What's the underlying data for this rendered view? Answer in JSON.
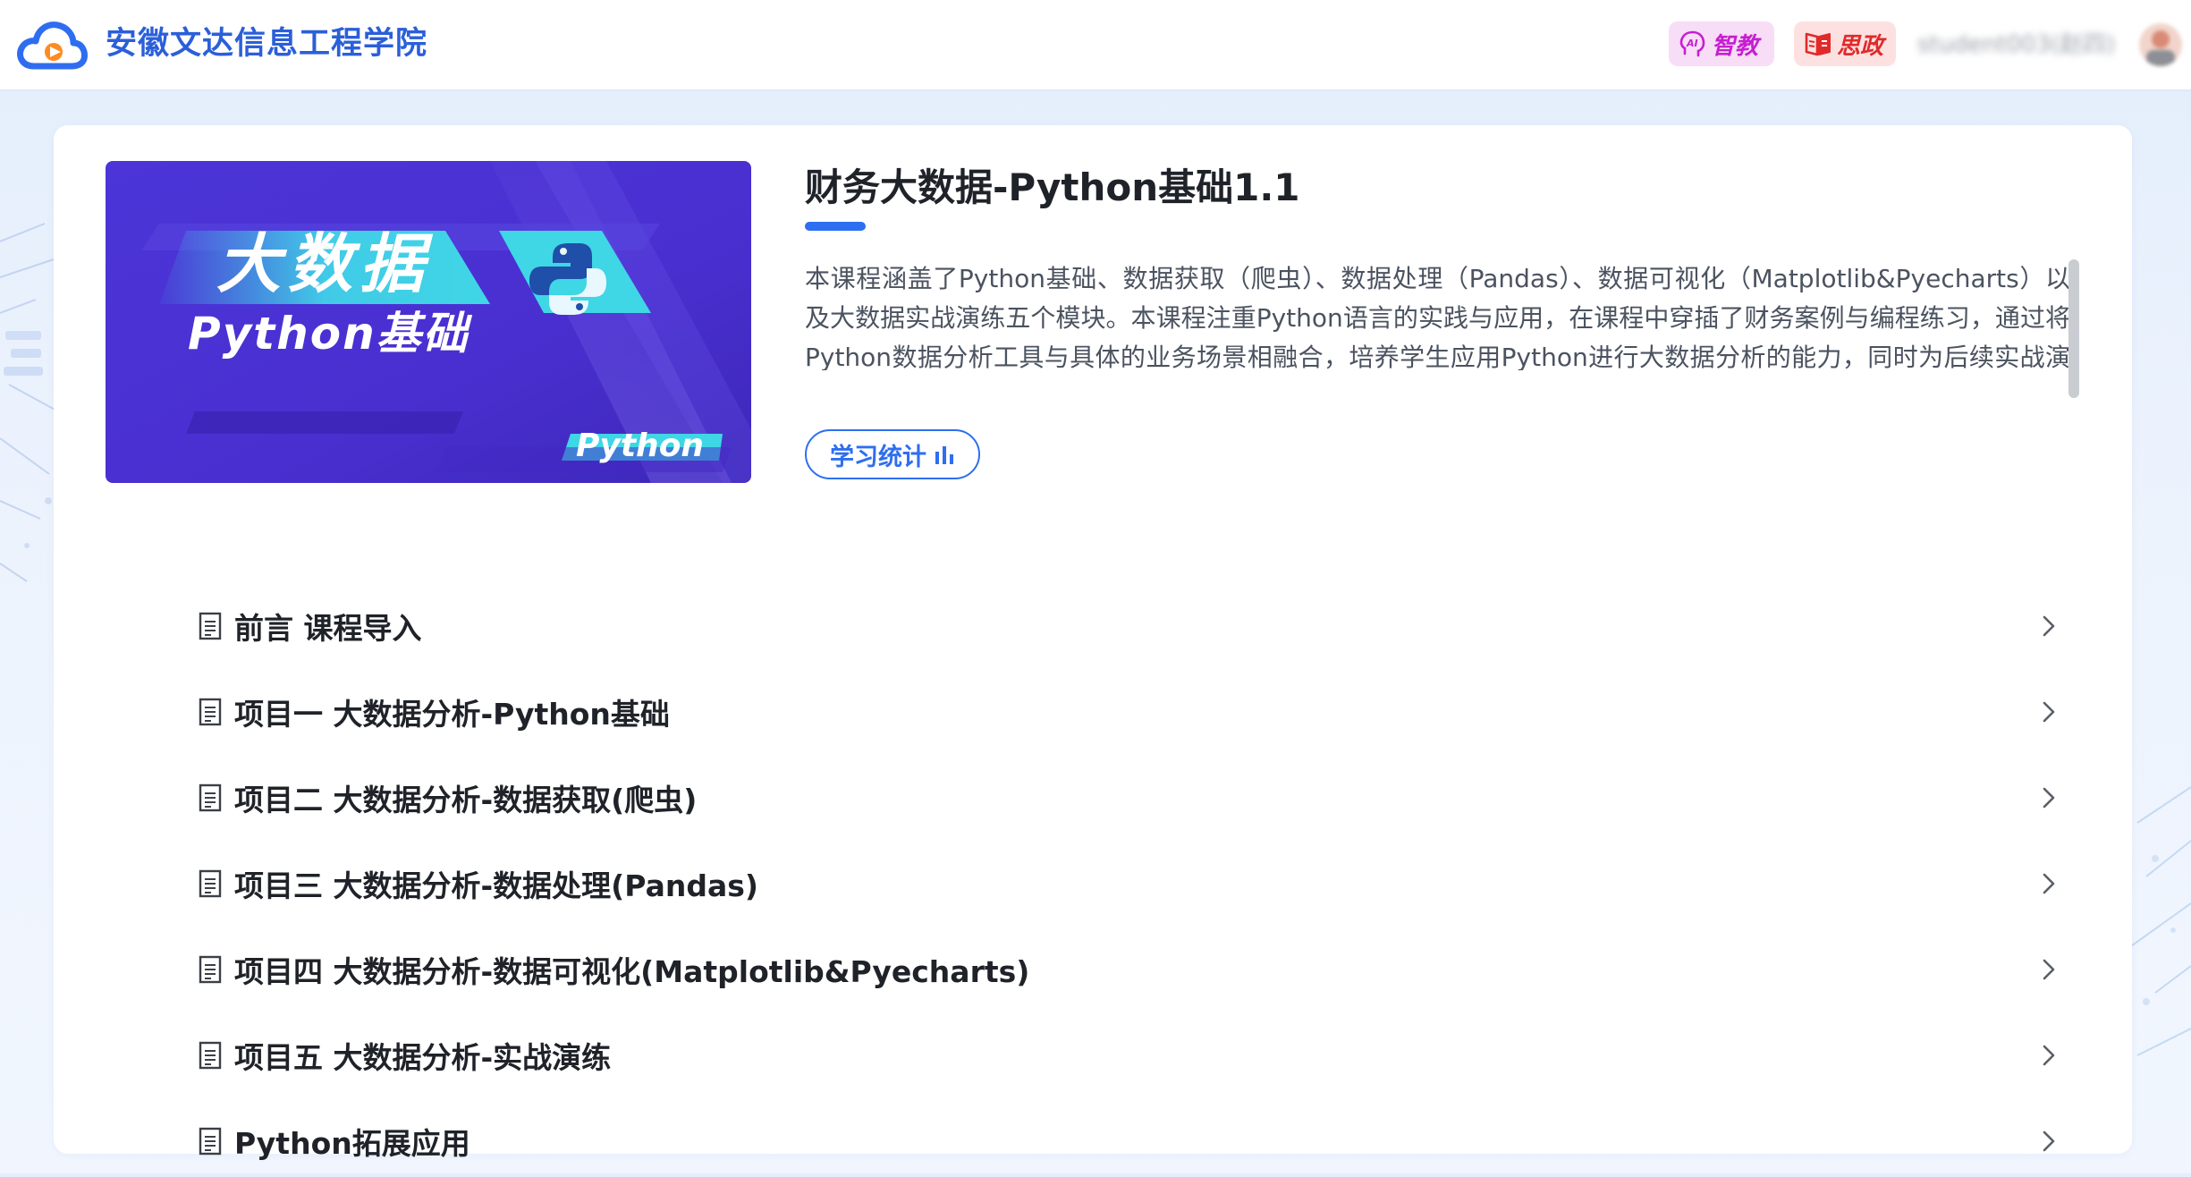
{
  "header": {
    "school_name": "安徽文达信息工程学院",
    "logo_icon": "cloud-logo-icon",
    "badges": [
      {
        "label": "智教",
        "icon": "ai-head-icon",
        "color": "#c51fd0"
      },
      {
        "label": "思政",
        "icon": "book-icon",
        "color": "#e02a2a"
      }
    ],
    "user_name": "student003(赵四)"
  },
  "course": {
    "cover": {
      "title": "大数据",
      "subtitle": "Python基础",
      "tag": "Python",
      "icon": "python-logo-icon"
    },
    "title": "财务大数据-Python基础1.1",
    "description": "本课程涵盖了Python基础、数据获取（爬虫）、数据处理（Pandas）、数据可视化（Matplotlib&Pyecharts）以及大数据实战演练五个模块。本课程注重Python语言的实践与应用，在课程中穿插了财务案例与编程练习，通过将Python数据分析工具与具体的业务场景相融合，培养学生应用Python进行大数据分析的能力，同时为后续实战演练打下坚实基础。",
    "stats_button_label": "学习统计",
    "stats_icon": "bar-chart-icon"
  },
  "chapters": [
    {
      "label": "前言 课程导入",
      "icon": "document-icon"
    },
    {
      "label": "项目一 大数据分析-Python基础",
      "icon": "document-icon"
    },
    {
      "label": "项目二 大数据分析-数据获取(爬虫)",
      "icon": "document-icon"
    },
    {
      "label": "项目三 大数据分析-数据处理(Pandas)",
      "icon": "document-icon"
    },
    {
      "label": "项目四 大数据分析-数据可视化(Matplotlib&Pyecharts)",
      "icon": "document-icon"
    },
    {
      "label": "项目五 大数据分析-实战演练",
      "icon": "document-icon"
    },
    {
      "label": "Python拓展应用",
      "icon": "document-icon"
    }
  ],
  "colors": {
    "accent": "#2e6ef0",
    "school_name": "#2b5fd9",
    "cover_bg": "#4a2fd4",
    "cover_accent": "#3fd6e6"
  }
}
